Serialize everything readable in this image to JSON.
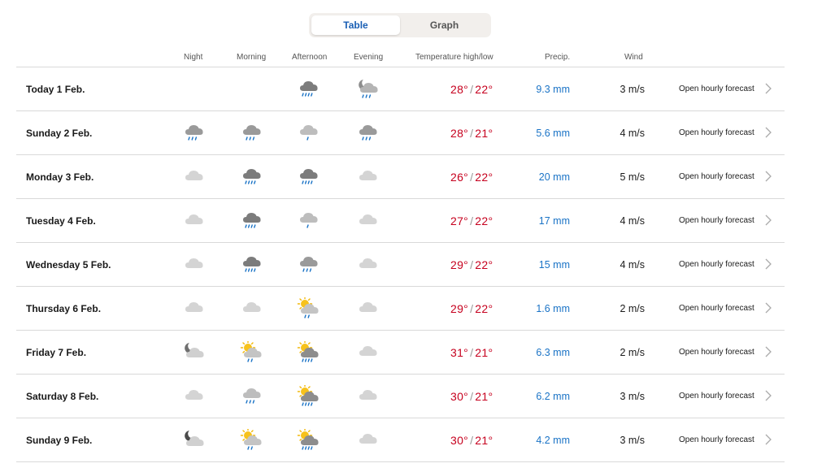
{
  "view_toggle": {
    "table_label": "Table",
    "graph_label": "Graph",
    "active": "Table"
  },
  "columns": {
    "night": "Night",
    "morning": "Morning",
    "afternoon": "Afternoon",
    "evening": "Evening",
    "temperature": "Temperature high/low",
    "precip": "Precip.",
    "wind": "Wind"
  },
  "colors": {
    "accent": "#1a5fb4",
    "temp": "#c6001e",
    "precip": "#1a73c6",
    "divider": "#d9d9d9"
  },
  "rows": [
    {
      "date": "Today 1 Feb.",
      "icons": [
        "",
        "",
        "rain-cloud-dark",
        "moon-rain-cloud"
      ],
      "high": "28°",
      "low": "22°",
      "precip": "9.3 mm",
      "wind": "3 m/s",
      "link": "Open hourly forecast"
    },
    {
      "date": "Sunday 2 Feb.",
      "icons": [
        "rain-cloud",
        "rain-cloud",
        "light-rain-cloud",
        "rain-cloud"
      ],
      "high": "28°",
      "low": "21°",
      "precip": "5.6 mm",
      "wind": "4 m/s",
      "link": "Open hourly forecast"
    },
    {
      "date": "Monday 3 Feb.",
      "icons": [
        "cloud",
        "heavy-rain-cloud",
        "heavy-rain-cloud",
        "cloud"
      ],
      "high": "26°",
      "low": "22°",
      "precip": "20 mm",
      "wind": "5 m/s",
      "link": "Open hourly forecast"
    },
    {
      "date": "Tuesday 4 Feb.",
      "icons": [
        "cloud",
        "heavy-rain-cloud",
        "light-rain-cloud",
        "cloud"
      ],
      "high": "27°",
      "low": "22°",
      "precip": "17 mm",
      "wind": "4 m/s",
      "link": "Open hourly forecast"
    },
    {
      "date": "Wednesday 5 Feb.",
      "icons": [
        "cloud",
        "heavy-rain-cloud",
        "rain-cloud",
        "cloud"
      ],
      "high": "29°",
      "low": "22°",
      "precip": "15 mm",
      "wind": "4 m/s",
      "link": "Open hourly forecast"
    },
    {
      "date": "Thursday 6 Feb.",
      "icons": [
        "cloud",
        "cloud",
        "sun-rain-cloud",
        "cloud"
      ],
      "high": "29°",
      "low": "22°",
      "precip": "1.6 mm",
      "wind": "2 m/s",
      "link": "Open hourly forecast"
    },
    {
      "date": "Friday 7 Feb.",
      "icons": [
        "moon-cloud",
        "sun-rain-cloud",
        "sun-heavy-rain-cloud",
        "cloud"
      ],
      "high": "31°",
      "low": "21°",
      "precip": "6.3 mm",
      "wind": "2 m/s",
      "link": "Open hourly forecast"
    },
    {
      "date": "Saturday 8 Feb.",
      "icons": [
        "cloud",
        "rain-cloud-light",
        "sun-heavy-rain-cloud",
        "cloud"
      ],
      "high": "30°",
      "low": "21°",
      "precip": "6.2 mm",
      "wind": "3 m/s",
      "link": "Open hourly forecast"
    },
    {
      "date": "Sunday 9 Feb.",
      "icons": [
        "moon-cloud-dark",
        "sun-rain-cloud",
        "sun-heavy-rain-cloud",
        "cloud"
      ],
      "high": "30°",
      "low": "21°",
      "precip": "4.2 mm",
      "wind": "3 m/s",
      "link": "Open hourly forecast"
    }
  ]
}
